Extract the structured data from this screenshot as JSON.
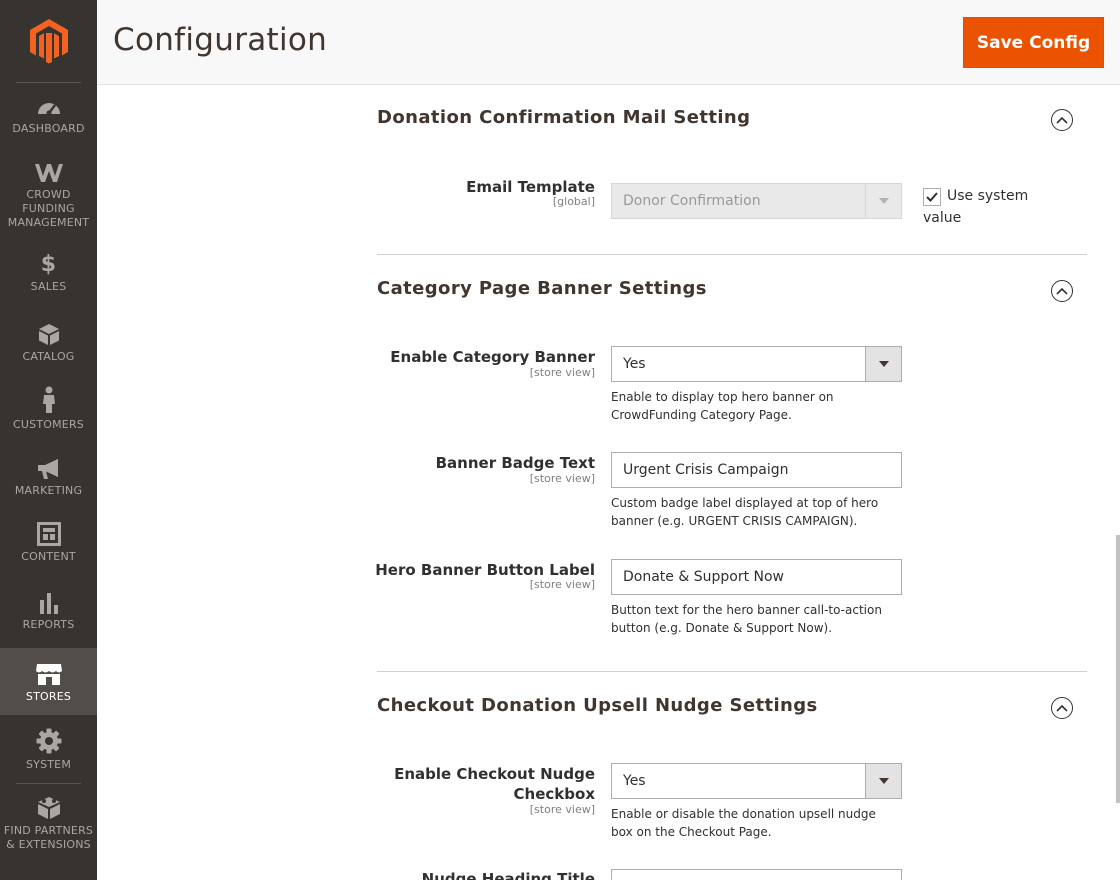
{
  "header": {
    "title": "Configuration",
    "save_label": "Save Config"
  },
  "colors": {
    "accent": "#eb5202",
    "sidebar_bg": "#373330",
    "sidebar_active": "#524d49"
  },
  "sidebar": {
    "items": [
      {
        "label": "DASHBOARD",
        "icon": "dashboard-icon"
      },
      {
        "label": "CROWD\nFUNDING\nMANAGEMENT",
        "icon": "crowdfunding-icon"
      },
      {
        "label": "SALES",
        "icon": "dollar-icon"
      },
      {
        "label": "CATALOG",
        "icon": "box-icon"
      },
      {
        "label": "CUSTOMERS",
        "icon": "person-icon"
      },
      {
        "label": "MARKETING",
        "icon": "megaphone-icon"
      },
      {
        "label": "CONTENT",
        "icon": "layout-icon"
      },
      {
        "label": "REPORTS",
        "icon": "bar-chart-icon"
      },
      {
        "label": "STORES",
        "icon": "store-icon",
        "active": true
      },
      {
        "label": "SYSTEM",
        "icon": "gear-icon"
      },
      {
        "label": "FIND PARTNERS\n& EXTENSIONS",
        "icon": "extensions-icon"
      }
    ]
  },
  "sections": [
    {
      "title": "Donation Confirmation Mail Setting",
      "fields": [
        {
          "label": "Email Template",
          "scope": "[global]",
          "value": "Donor Confirmation",
          "use_system_value": "Use system",
          "use_system_value_2": "value"
        }
      ]
    },
    {
      "title": "Category Page Banner Settings",
      "fields": [
        {
          "label": "Enable Category Banner",
          "scope": "[store view]",
          "value": "Yes",
          "note": "Enable to display top hero banner on CrowdFunding Category Page."
        },
        {
          "label": "Banner Badge Text",
          "scope": "[store view]",
          "value": "Urgent Crisis Campaign",
          "note": "Custom badge label displayed at top of hero banner (e.g. URGENT CRISIS CAMPAIGN)."
        },
        {
          "label": "Hero Banner Button Label",
          "scope": "[store view]",
          "value": "Donate & Support Now",
          "note": "Button text for the hero banner call-to-action button (e.g. Donate & Support Now)."
        }
      ]
    },
    {
      "title": "Checkout Donation Upsell Nudge Settings",
      "fields": [
        {
          "label": "Enable Checkout Nudge\nCheckbox",
          "scope": "[store view]",
          "value": "Yes",
          "note": "Enable or disable the donation upsell nudge box on the Checkout Page."
        },
        {
          "label": "Nudge Heading Title"
        }
      ]
    }
  ]
}
